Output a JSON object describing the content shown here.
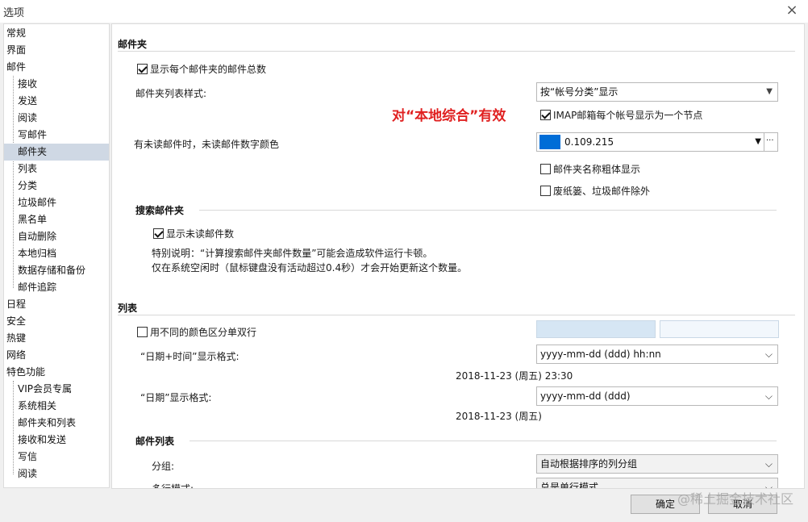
{
  "window": {
    "title": "选项",
    "close_icon": "×"
  },
  "sidebar": {
    "items": [
      {
        "label": "常规",
        "level": 0
      },
      {
        "label": "界面",
        "level": 0
      },
      {
        "label": "邮件",
        "level": 0
      },
      {
        "label": "接收",
        "level": 1
      },
      {
        "label": "发送",
        "level": 1
      },
      {
        "label": "阅读",
        "level": 1
      },
      {
        "label": "写邮件",
        "level": 1
      },
      {
        "label": "邮件夹",
        "level": 1,
        "selected": true
      },
      {
        "label": "列表",
        "level": 1
      },
      {
        "label": "分类",
        "level": 1
      },
      {
        "label": "垃圾邮件",
        "level": 1
      },
      {
        "label": "黑名单",
        "level": 1
      },
      {
        "label": "自动删除",
        "level": 1
      },
      {
        "label": "本地归档",
        "level": 1
      },
      {
        "label": "数据存储和备份",
        "level": 1
      },
      {
        "label": "邮件追踪",
        "level": 1
      },
      {
        "label": "日程",
        "level": 0
      },
      {
        "label": "安全",
        "level": 0
      },
      {
        "label": "热键",
        "level": 0
      },
      {
        "label": "网络",
        "level": 0
      },
      {
        "label": "特色功能",
        "level": 0
      },
      {
        "label": "VIP会员专属",
        "level": 1
      },
      {
        "label": "系统相关",
        "level": 1
      },
      {
        "label": "邮件夹和列表",
        "level": 1
      },
      {
        "label": "接收和发送",
        "level": 1
      },
      {
        "label": "写信",
        "level": 1
      },
      {
        "label": "阅读",
        "level": 1
      }
    ]
  },
  "folder": {
    "section_title": "邮件夹",
    "show_total_label": "显示每个邮件夹的邮件总数",
    "show_total_checked": true,
    "list_style_label": "邮件夹列表样式:",
    "list_style_value": "按“帐号分类”显示",
    "annotation": "对“本地综合”有效",
    "imap_node_label": "IMAP邮箱每个帐号显示为一个节点",
    "imap_node_checked": true,
    "unread_color_label": "有未读邮件时，未读邮件数字颜色",
    "unread_color_value": "0.109.215",
    "unread_color_hex": "#006dd7",
    "more_label": "···",
    "bold_name_label": "邮件夹名称粗体显示",
    "bold_name_checked": false,
    "exclude_trash_label": "废纸篓、垃圾邮件除外",
    "exclude_trash_checked": false
  },
  "search_folder": {
    "section_title": "搜索邮件夹",
    "show_unread_label": "显示未读邮件数",
    "show_unread_checked": true,
    "note_line1": "特别说明：“计算搜索邮件夹邮件数量”可能会造成软件运行卡顿。",
    "note_line2": "仅在系统空闲时（鼠标键盘没有活动超过0.4秒）才会开始更新这个数量。"
  },
  "list": {
    "section_title": "列表",
    "alt_rows_label": "用不同的颜色区分单双行",
    "alt_rows_checked": false,
    "alt_color1": "#d6e6f4",
    "alt_color2": "#f2f7fc",
    "datetime_label": "“日期+时间”显示格式:",
    "datetime_value": "yyyy-mm-dd (ddd) hh:nn",
    "datetime_preview": "2018-11-23 (周五) 23:30",
    "date_label": "“日期”显示格式:",
    "date_value": "yyyy-mm-dd (ddd)",
    "date_preview": "2018-11-23 (周五)"
  },
  "mail_list": {
    "section_title": "邮件列表",
    "group_label": "分组:",
    "group_value": "自动根据排序的列分组",
    "multiline_label": "多行模式:",
    "multiline_value": "总是单行模式"
  },
  "buttons": {
    "ok": "确定",
    "cancel": "取消"
  },
  "watermark": "@稀土掘金技术社区"
}
